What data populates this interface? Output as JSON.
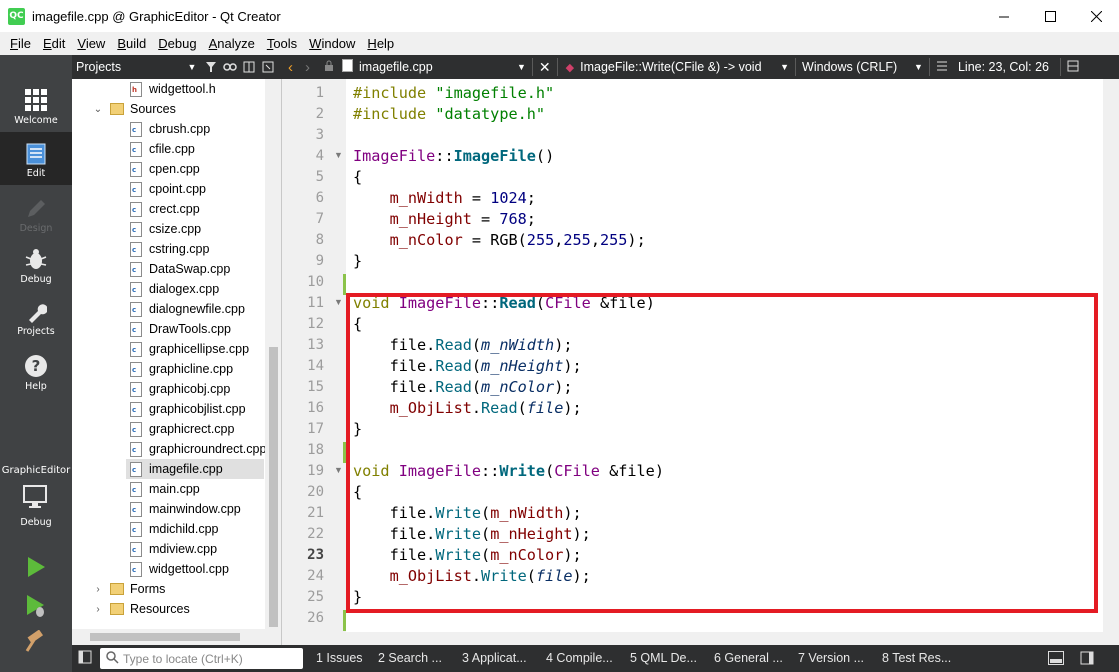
{
  "window": {
    "title": "imagefile.cpp @ GraphicEditor - Qt Creator",
    "app_icon": "QC"
  },
  "menu": [
    "File",
    "Edit",
    "View",
    "Build",
    "Debug",
    "Analyze",
    "Tools",
    "Window",
    "Help"
  ],
  "modes": [
    {
      "label": "Welcome",
      "icon": "grid-icon"
    },
    {
      "label": "Edit",
      "icon": "document-icon"
    },
    {
      "label": "Design",
      "icon": "pencil-icon"
    },
    {
      "label": "Debug",
      "icon": "bug-icon"
    },
    {
      "label": "Projects",
      "icon": "wrench-icon"
    },
    {
      "label": "Help",
      "icon": "question-icon"
    }
  ],
  "kit": {
    "project": "GraphicEditor",
    "mode": "Debug"
  },
  "project_pane": {
    "title": "Projects",
    "tree": {
      "top_file": "widgettool.h",
      "sources_label": "Sources",
      "sources": [
        "cbrush.cpp",
        "cfile.cpp",
        "cpen.cpp",
        "cpoint.cpp",
        "crect.cpp",
        "csize.cpp",
        "cstring.cpp",
        "DataSwap.cpp",
        "dialogex.cpp",
        "dialognewfile.cpp",
        "DrawTools.cpp",
        "graphicellipse.cpp",
        "graphicline.cpp",
        "graphicobj.cpp",
        "graphicobjlist.cpp",
        "graphicrect.cpp",
        "graphicroundrect.cpp",
        "imagefile.cpp",
        "main.cpp",
        "mainwindow.cpp",
        "mdichild.cpp",
        "mdiview.cpp",
        "widgettool.cpp"
      ],
      "selected": "imagefile.cpp",
      "folders_after": [
        "Forms",
        "Resources"
      ]
    }
  },
  "editor": {
    "file": "imagefile.cpp",
    "symbol": "ImageFile::Write(CFile &) -> void",
    "line_ending": "Windows (CRLF)",
    "position": "Line: 23, Col: 26",
    "current_line": 23,
    "highlight_lines": [
      11,
      25
    ],
    "lines": [
      "#include \"imagefile.h\"",
      "#include \"datatype.h\"",
      "",
      "ImageFile::ImageFile()",
      "{",
      "    m_nWidth = 1024;",
      "    m_nHeight = 768;",
      "    m_nColor = RGB(255,255,255);",
      "}",
      "",
      "void ImageFile::Read(CFile &file)",
      "{",
      "    file.Read(m_nWidth);",
      "    file.Read(m_nHeight);",
      "    file.Read(m_nColor);",
      "    m_ObjList.Read(file);",
      "}",
      "",
      "void ImageFile::Write(CFile &file)",
      "{",
      "    file.Write(m_nWidth);",
      "    file.Write(m_nHeight);",
      "    file.Write(m_nColor);",
      "    m_ObjList.Write(file);",
      "}",
      ""
    ]
  },
  "statusbar": {
    "locator_placeholder": "Type to locate (Ctrl+K)",
    "tabs": [
      "1  Issues",
      "2  Search ...",
      "3  Applicat...",
      "4  Compile...",
      "5  QML De...",
      "6  General ...",
      "7  Version ...",
      "8  Test Res..."
    ]
  },
  "colors": {
    "highlight_box": "#e41b23",
    "mode_bar": "#404244",
    "pane_header": "#2e2f30"
  }
}
